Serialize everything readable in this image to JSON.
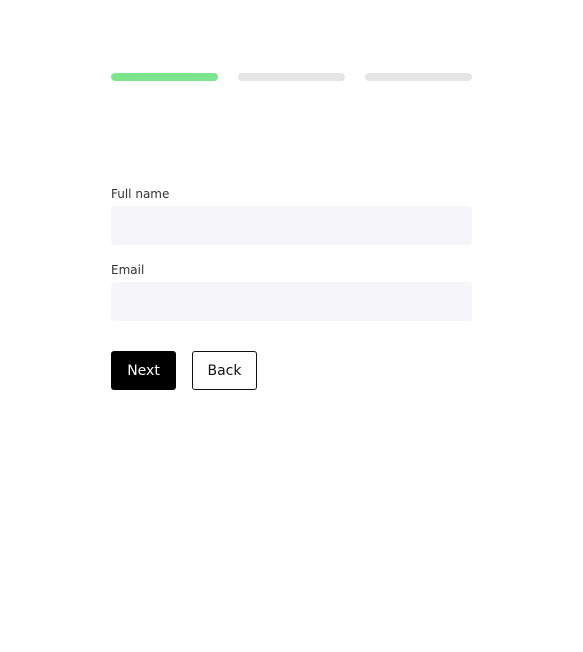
{
  "progress": {
    "current_step": 1,
    "total_steps": 3,
    "active_color": "#7ee58f",
    "inactive_color": "#e5e5e5"
  },
  "form": {
    "full_name": {
      "label": "Full name",
      "value": "",
      "placeholder": ""
    },
    "email": {
      "label": "Email",
      "value": "",
      "placeholder": ""
    }
  },
  "buttons": {
    "next": "Next",
    "back": "Back"
  }
}
